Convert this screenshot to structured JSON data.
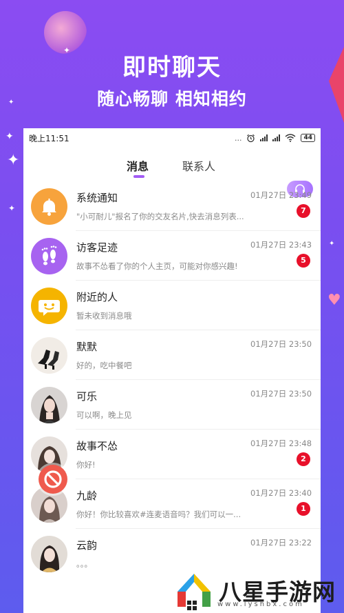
{
  "promo": {
    "title": "即时聊天",
    "subtitle": "随心畅聊 相知相约"
  },
  "statusbar": {
    "time": "晚上11:51",
    "battery": "44",
    "dots": "..."
  },
  "tabs": [
    {
      "label": "消息",
      "active": true
    },
    {
      "label": "联系人",
      "active": false
    }
  ],
  "headset_icon": "headset-icon",
  "conversations": [
    {
      "name": "系统通知",
      "preview": "\"小可耐儿\"报名了你的交友名片,快去消息列表...",
      "time": "01月27日 23:49",
      "badge": "7",
      "avatar": "bell-icon"
    },
    {
      "name": "访客足迹",
      "preview": "故事不怂看了你的个人主页，可能对你感兴趣!",
      "time": "01月27日 23:43",
      "badge": "5",
      "avatar": "footprints-icon"
    },
    {
      "name": "附近的人",
      "preview": "暂未收到消息哦",
      "time": "",
      "badge": "",
      "avatar": "chat-smile-icon"
    },
    {
      "name": "默默",
      "preview": "好的，吃中餐吧",
      "time": "01月27日 23:50",
      "badge": "",
      "avatar": "photo-shoes"
    },
    {
      "name": "可乐",
      "preview": "可以啊，晚上见",
      "time": "01月27日 23:50",
      "badge": "",
      "avatar": "photo-woman"
    },
    {
      "name": "故事不怂",
      "preview": "你好!",
      "time": "01月27日 23:48",
      "badge": "2",
      "avatar": "photo-woman"
    },
    {
      "name": "九龄",
      "preview": "你好！你比较喜欢#连麦语音吗？我们可以一...",
      "time": "01月27日 23:40",
      "badge": "1",
      "avatar": "photo-woman"
    },
    {
      "name": "云韵",
      "preview": "。。。",
      "time": "01月27日 23:22",
      "badge": "",
      "avatar": "photo-woman"
    }
  ],
  "watermark": {
    "text": "八星手游网",
    "url": "www.lyshbx.com"
  },
  "colors": {
    "background": "#7b4ef0",
    "accent": "#a35cf5",
    "badge": "#e8102a"
  }
}
